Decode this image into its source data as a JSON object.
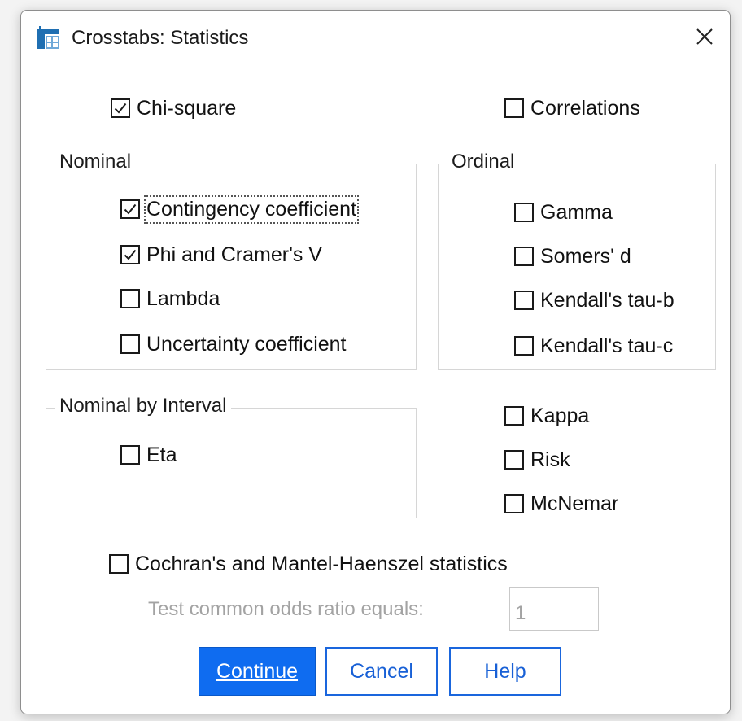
{
  "window": {
    "title": "Crosstabs: Statistics",
    "icon": "spss-table-icon"
  },
  "top_options": {
    "chi_square": {
      "label": "Chi-square",
      "checked": true
    },
    "correlations": {
      "label": "Correlations",
      "checked": false
    }
  },
  "nominal": {
    "legend": "Nominal",
    "items": [
      {
        "label": "Contingency coefficient",
        "checked": true
      },
      {
        "label": "Phi and Cramer's V",
        "checked": true
      },
      {
        "label": "Lambda",
        "checked": false
      },
      {
        "label": "Uncertainty coefficient",
        "checked": false
      }
    ]
  },
  "ordinal": {
    "legend": "Ordinal",
    "items": [
      {
        "label": "Gamma",
        "checked": false
      },
      {
        "label": "Somers' d",
        "checked": false
      },
      {
        "label": "Kendall's tau-b",
        "checked": false
      },
      {
        "label": "Kendall's tau-c",
        "checked": false
      }
    ]
  },
  "nominal_by_interval": {
    "legend": "Nominal by Interval",
    "items": [
      {
        "label": "Eta",
        "checked": false
      }
    ]
  },
  "other_options": [
    {
      "label": "Kappa",
      "checked": false
    },
    {
      "label": "Risk",
      "checked": false
    },
    {
      "label": "McNemar",
      "checked": false
    }
  ],
  "cmh": {
    "label": "Cochran's and Mantel-Haenszel statistics",
    "checked": false,
    "odds_label": "Test common odds ratio equals:",
    "odds_value": "1"
  },
  "buttons": {
    "continue": "Continue",
    "cancel": "Cancel",
    "help": "Help"
  },
  "colors": {
    "primary": "#0f6cf0",
    "check": "#1a1a1a",
    "disabled_text": "#a3a3a3"
  }
}
